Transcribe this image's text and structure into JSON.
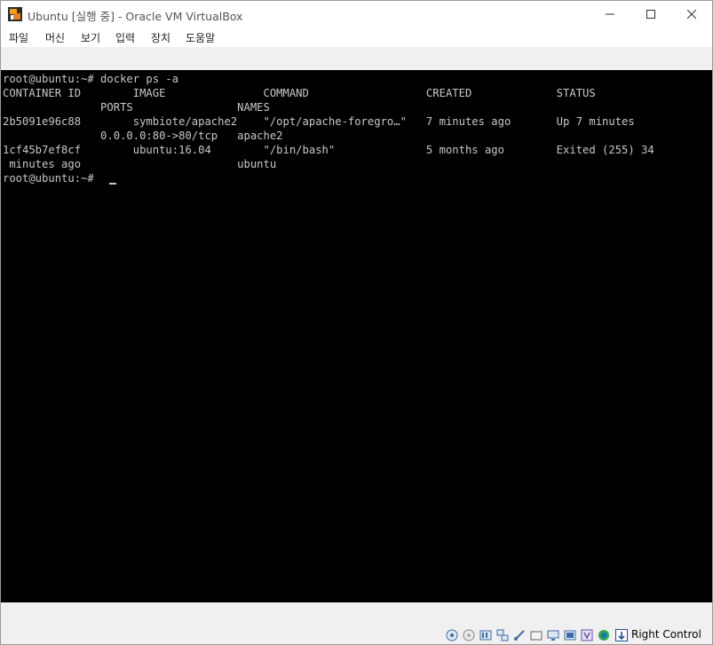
{
  "window": {
    "title": "Ubuntu [실행 중] - Oracle VM VirtualBox"
  },
  "menu": [
    "파일",
    "머신",
    "보기",
    "입력",
    "장치",
    "도움말"
  ],
  "terminal": {
    "lines": [
      "root@ubuntu:~# docker ps -a",
      "CONTAINER ID        IMAGE               COMMAND                  CREATED             STATUS",
      "               PORTS                NAMES",
      "2b5091e96c88        symbiote/apache2    \"/opt/apache-foregro…\"   7 minutes ago       Up 7 minutes",
      "               0.0.0.0:80->80/tcp   apache2",
      "1cf45b7ef8cf        ubuntu:16.04        \"/bin/bash\"              5 months ago        Exited (255) 34",
      " minutes ago                        ubuntu",
      "root@ubuntu:~# "
    ]
  },
  "statusbar": {
    "icons": [
      "hard-disk-icon",
      "optical-drive-icon",
      "audio-icon",
      "network-icon",
      "usb-icon",
      "shared-folders-icon",
      "display-icon",
      "recording-icon",
      "cpu-icon",
      "mouse-integration-icon",
      "host-key-arrow-icon"
    ],
    "host_key": "Right Control"
  },
  "colors": {
    "terminal_bg": "#000000",
    "terminal_fg": "#c8c8c8",
    "chrome_bg": "#f0f0f0"
  }
}
